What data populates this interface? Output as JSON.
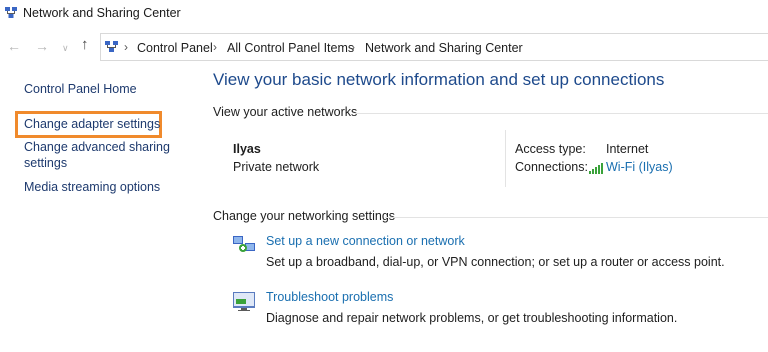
{
  "window": {
    "title": "Network and Sharing Center"
  },
  "nav": {
    "back_glyph": "←",
    "forward_glyph": "→",
    "dropdown_glyph": "∨",
    "up_glyph": "↑"
  },
  "breadcrumb": {
    "items": [
      "Control Panel",
      "All Control Panel Items",
      "Network and Sharing Center"
    ],
    "separator": "›"
  },
  "sidebar": {
    "items": [
      {
        "label": "Control Panel Home"
      },
      {
        "label": "Change adapter settings",
        "highlighted": true
      },
      {
        "label_line1": "Change advanced sharing",
        "label_line2": "settings"
      },
      {
        "label": "Media streaming options"
      }
    ],
    "highlight_color": "#f08a2c"
  },
  "main": {
    "heading": "View your basic network information and set up connections",
    "active_networks_label": "View your active networks",
    "network": {
      "name": "Ilyas",
      "type": "Private network",
      "access_type_label": "Access type:",
      "access_type_value": "Internet",
      "connections_label": "Connections:",
      "connections_value": "Wi-Fi (Ilyas)"
    },
    "settings_label": "Change your networking settings",
    "tasks": [
      {
        "icon": "network-setup-icon",
        "link": "Set up a new connection or network",
        "description": "Set up a broadband, dial-up, or VPN connection; or set up a router or access point."
      },
      {
        "icon": "troubleshoot-icon",
        "link": "Troubleshoot problems",
        "description": "Diagnose and repair network problems, or get troubleshooting information."
      }
    ]
  },
  "colors": {
    "heading": "#1e4a8c",
    "link": "#1a6fb0",
    "wifi_signal": "#3aa23a"
  }
}
